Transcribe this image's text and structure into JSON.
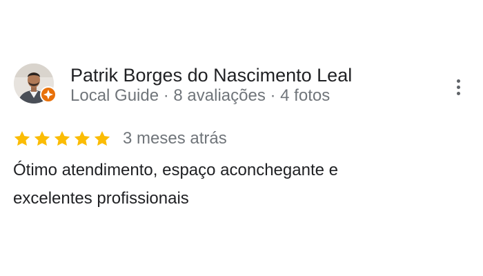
{
  "reviewer": {
    "name": "Patrik Borges do Nascimento Leal",
    "meta": "Local Guide · 8 avaliações · 4 fotos"
  },
  "rating": {
    "stars": 5,
    "max_stars": 5,
    "star_color": "#fbbc04",
    "date": "3 meses atrás"
  },
  "review": {
    "text": "Ótimo atendimento, espaço aconchegante e excelentes profissionais"
  },
  "colors": {
    "badge": "#e8710a",
    "secondary_text": "#70757a"
  }
}
